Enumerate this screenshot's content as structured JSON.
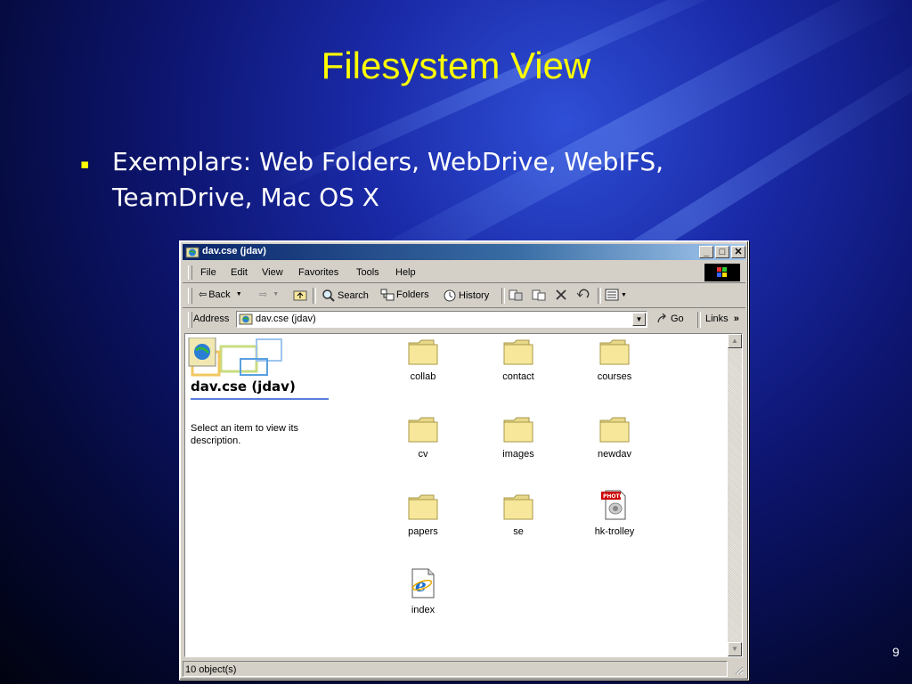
{
  "slide": {
    "title": "Filesystem View",
    "bullet_glyph": "▪",
    "bullet_line1": "Exemplars: Web Folders, WebDrive, WebIFS,",
    "bullet_line2": "TeamDrive, Mac OS X",
    "page_number": "9"
  },
  "window": {
    "title": "dav.cse (jdav)",
    "minimize": "_",
    "maximize": "□",
    "close": "✕",
    "menu": [
      "File",
      "Edit",
      "View",
      "Favorites",
      "Tools",
      "Help"
    ],
    "toolbar": {
      "back": "Back",
      "search": "Search",
      "folders": "Folders",
      "history": "History"
    },
    "address": {
      "label": "Address",
      "value": "dav.cse (jdav)",
      "go": "Go",
      "links": "Links"
    },
    "left_pane": {
      "folder_title": "dav.cse (jdav)",
      "description": "Select an item to view its description."
    },
    "items": [
      {
        "label": "collab",
        "type": "folder"
      },
      {
        "label": "contact",
        "type": "folder"
      },
      {
        "label": "courses",
        "type": "folder"
      },
      {
        "label": "cv",
        "type": "folder"
      },
      {
        "label": "images",
        "type": "folder"
      },
      {
        "label": "newdav",
        "type": "folder"
      },
      {
        "label": "papers",
        "type": "folder"
      },
      {
        "label": "se",
        "type": "folder"
      },
      {
        "label": "hk-trolley",
        "type": "photo"
      },
      {
        "label": "index",
        "type": "html"
      }
    ],
    "status": "10 object(s)"
  },
  "colors": {
    "title_yellow": "#ffff00",
    "titlebar_start": "#0a246a",
    "titlebar_end": "#a6caf0",
    "folder_fill": "#f7e79a"
  },
  "icons": {
    "folder": "folder-icon",
    "photo": "photo-file-icon",
    "html": "ie-document-icon"
  }
}
